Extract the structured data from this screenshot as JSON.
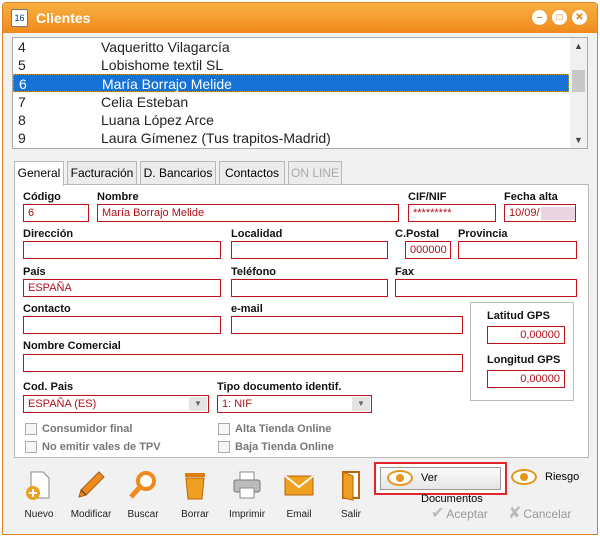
{
  "window": {
    "title": "Clientes",
    "icon_text": "16",
    "controls": [
      "minimize",
      "maximize",
      "close"
    ]
  },
  "clients_list": [
    {
      "id": "4",
      "name": "Vaqueritto Vilagarcía"
    },
    {
      "id": "5",
      "name": "Lobishome textil SL"
    },
    {
      "id": "6",
      "name": "María Borrajo Melide"
    },
    {
      "id": "7",
      "name": "Celia Esteban"
    },
    {
      "id": "8",
      "name": "Luana López Arce"
    },
    {
      "id": "9",
      "name": "Laura Gímenez (Tus trapitos-Madrid)"
    }
  ],
  "selected_row": "6",
  "tabs": [
    {
      "label": "General",
      "active": true
    },
    {
      "label": "Facturación"
    },
    {
      "label": "D. Bancarios"
    },
    {
      "label": "Contactos"
    },
    {
      "label": "ON LINE",
      "disabled": true
    }
  ],
  "form": {
    "codigo": {
      "label": "Código",
      "value": "6"
    },
    "nombre": {
      "label": "Nombre",
      "value": "María Borrajo Melide"
    },
    "cif": {
      "label": "CIF/NIF",
      "value": "*********"
    },
    "fecha_alta": {
      "label": "Fecha alta",
      "value": "10/09/"
    },
    "direccion": {
      "label": "Dirección",
      "value": ""
    },
    "localidad": {
      "label": "Localidad",
      "value": ""
    },
    "cpostal": {
      "label": "C.Postal",
      "value": "000000"
    },
    "provincia": {
      "label": "Provincia",
      "value": ""
    },
    "pais": {
      "label": "País",
      "value": "ESPAÑA"
    },
    "telefono": {
      "label": "Teléfono",
      "value": ""
    },
    "fax": {
      "label": "Fax",
      "value": ""
    },
    "contacto": {
      "label": "Contacto",
      "value": ""
    },
    "email": {
      "label": "e-mail",
      "value": ""
    },
    "latitud": {
      "label": "Latitud GPS",
      "value": "0,00000"
    },
    "longitud": {
      "label": "Longitud GPS",
      "value": "0,00000"
    },
    "nombre_comercial": {
      "label": "Nombre Comercial",
      "value": ""
    },
    "cod_pais": {
      "label": "Cod. Pais",
      "value": "ESPAÑA  (ES)"
    },
    "tipo_doc": {
      "label": "Tipo documento identif.",
      "value": "1: NIF"
    },
    "consumidor_final": {
      "label": "Consumidor final",
      "checked": false
    },
    "no_emitir_vales": {
      "label": "No emitir vales de TPV",
      "checked": false
    },
    "alta_tienda": {
      "label": "Alta Tienda Online",
      "checked": false
    },
    "baja_tienda": {
      "label": "Baja Tienda Online",
      "checked": false
    }
  },
  "toolbar": {
    "nuevo": "Nuevo",
    "modificar": "Modificar",
    "buscar": "Buscar",
    "borrar": "Borrar",
    "imprimir": "Imprimir",
    "email": "Email",
    "salir": "Salir"
  },
  "actions": {
    "ver_documentos": "Ver Documentos",
    "riesgo": "Riesgo",
    "aceptar": "Aceptar",
    "cancelar": "Cancelar"
  },
  "colors": {
    "titlebar": "#f08a1c",
    "selection": "#1672d6",
    "field_border": "#c0121b",
    "field_text": "#b0101a"
  }
}
